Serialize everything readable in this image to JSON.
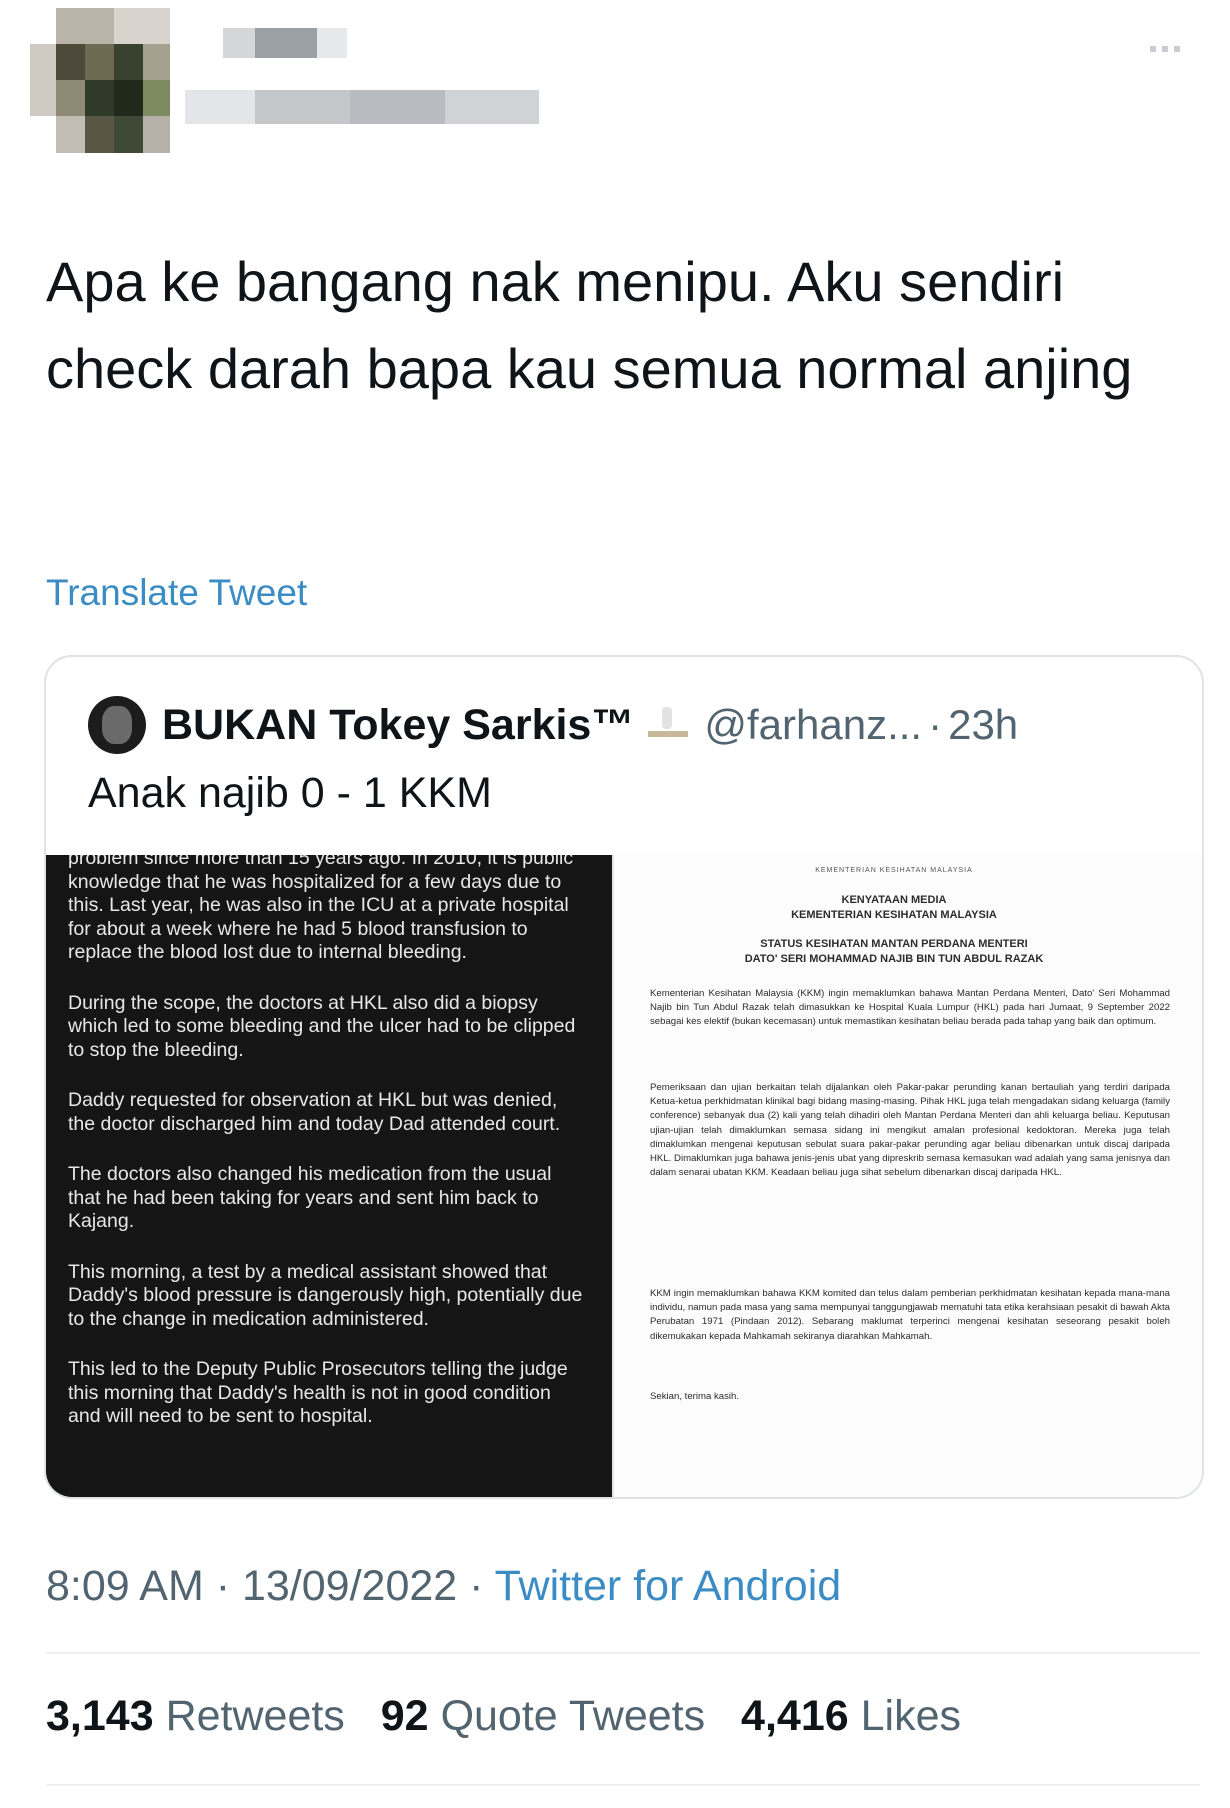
{
  "header": {
    "avatar_colors": [
      "#9c9487",
      "#4a4634",
      "#6e6a52",
      "#2f3a28",
      "#7d8a5f",
      "#b5b0a8",
      "#3e4a36",
      "#8c8878"
    ],
    "name_bar_colors": [
      "#d4d6d8",
      "#9aa0a6",
      "#c4c7ca",
      "#e6e8ea"
    ],
    "menu_icon": "more-horizontal-icon"
  },
  "tweet": {
    "text": "Apa ke bangang nak menipu. Aku sendiri check darah bapa kau semua normal anjing",
    "translate_label": "Translate Tweet",
    "timestamp": "8:09 AM · 13/09/2022 · ",
    "source": "Twitter for Android"
  },
  "quoted_tweet": {
    "display_name": "BUKAN Tokey Sarkis™",
    "handle": "@farhanz...",
    "separator": "·",
    "time_ago": "23h",
    "text": "Anak najib 0 - 1 KKM",
    "left_image_paragraphs": [
      "problem since more than 15 years ago. In 2010, it is public knowledge that he was hospitalized for a few days due to this. Last year, he was also in the ICU at a private hospital for about a week where he had 5 blood transfusion to replace the blood lost due to internal bleeding.",
      "During the scope, the doctors at HKL also did a biopsy which led to some bleeding and the ulcer had to be clipped to stop the bleeding.",
      "Daddy requested for observation at HKL but was denied, the doctor discharged him and today Dad attended court.",
      "The doctors also changed his medication from the usual that he had been taking for years and sent him back to Kajang.",
      "This morning, a test by a medical assistant showed that Daddy's blood pressure is dangerously high, potentially due to the change in medication administered.",
      "This led to the Deputy Public Prosecutors telling the judge this morning that Daddy's health is not in good condition and will need to be sent to hospital."
    ],
    "right_image": {
      "ministry_top": "KEMENTERIAN KESIHATAN MALAYSIA",
      "title_line1": "KENYATAAN MEDIA",
      "title_line2": "KEMENTERIAN KESIHATAN MALAYSIA",
      "status_line1": "STATUS KESIHATAN MANTAN PERDANA MENTERI",
      "status_line2": "DATO' SERI MOHAMMAD NAJIB BIN TUN ABDUL RAZAK",
      "para1": "Kementerian Kesihatan Malaysia (KKM) ingin memaklumkan bahawa Mantan Perdana Menteri, Dato' Seri Mohammad Najib bin Tun Abdul Razak telah dimasukkan ke Hospital Kuala Lumpur (HKL) pada hari Jumaat, 9 September 2022 sebagai kes elektif (bukan kecemasan) untuk memastikan kesihatan beliau berada pada tahap yang baik dan optimum.",
      "para2": "Pemeriksaan dan ujian berkaitan telah dijalankan oleh Pakar-pakar perunding kanan bertauliah yang terdiri daripada Ketua-ketua perkhidmatan klinikal bagi bidang masing-masing. Pihak HKL juga telah mengadakan sidang keluarga (family conference) sebanyak dua (2) kali yang telah dihadiri oleh Mantan Perdana Menteri dan ahli keluarga beliau. Keputusan ujian-ujian telah dimaklumkan semasa sidang ini mengikut amalan profesional kedoktoran. Mereka juga telah dimaklumkan mengenai keputusan sebulat suara pakar-pakar perunding agar beliau dibenarkan untuk discaj daripada HKL. Dimaklumkan juga bahawa jenis-jenis ubat yang dipreskrib semasa kemasukan wad adalah yang sama jenisnya dan dalam senarai ubatan KKM. Keadaan beliau juga sihat sebelum dibenarkan discaj daripada HKL.",
      "para3": "KKM ingin memaklumkan bahawa KKM komited dan telus dalam pemberian perkhidmatan kesihatan kepada mana-mana individu, namun pada masa yang sama mempunyai tanggungjawab mematuhi tata etika kerahsiaan pesakit di bawah Akta Perubatan 1971 (Pindaan 2012). Sebarang maklumat terperinci mengenai kesihatan seseorang pesakit boleh dikemukakan kepada Mahkamah sekiranya diarahkan Mahkamah.",
      "closing": "Sekian, terima kasih."
    }
  },
  "stats": {
    "retweets_count": "3,143",
    "retweets_label": "Retweets",
    "quotes_count": "92",
    "quotes_label": "Quote Tweets",
    "likes_count": "4,416",
    "likes_label": "Likes"
  },
  "colors": {
    "link": "#3b8cc4",
    "muted": "#536471",
    "text": "#0f1419"
  }
}
